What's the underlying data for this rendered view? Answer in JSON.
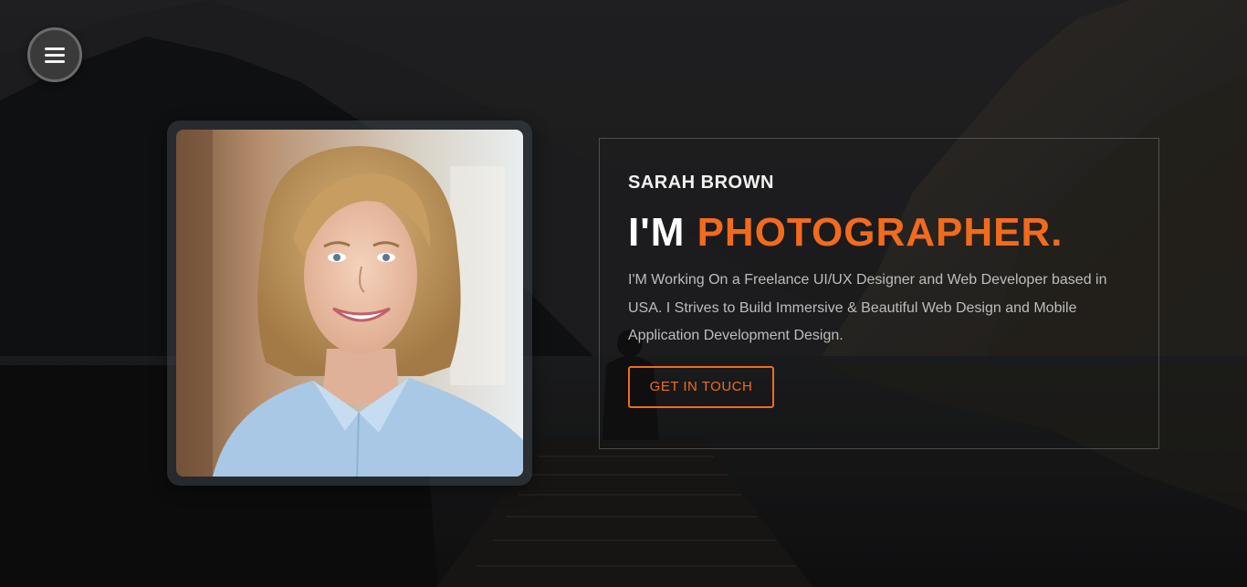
{
  "menu": {
    "icon": "hamburger-menu-icon"
  },
  "profile": {
    "photo_alt": "Portrait of a smiling woman",
    "name": "SARAH BROWN",
    "headline_lead": "I'M",
    "headline_accent": "PHOTOGRAPHER.",
    "bio": "I'M Working On a Freelance UI/UX Designer and Web Developer based in USA. I Strives to Build Immersive & Beautiful Web Design and Mobile Application Development Design.",
    "cta_label": "GET IN TOUCH"
  },
  "colors": {
    "accent": "#f26b1d",
    "background": "#1a1a1c",
    "text_primary": "#ffffff",
    "text_muted": "#bdbdbd"
  }
}
